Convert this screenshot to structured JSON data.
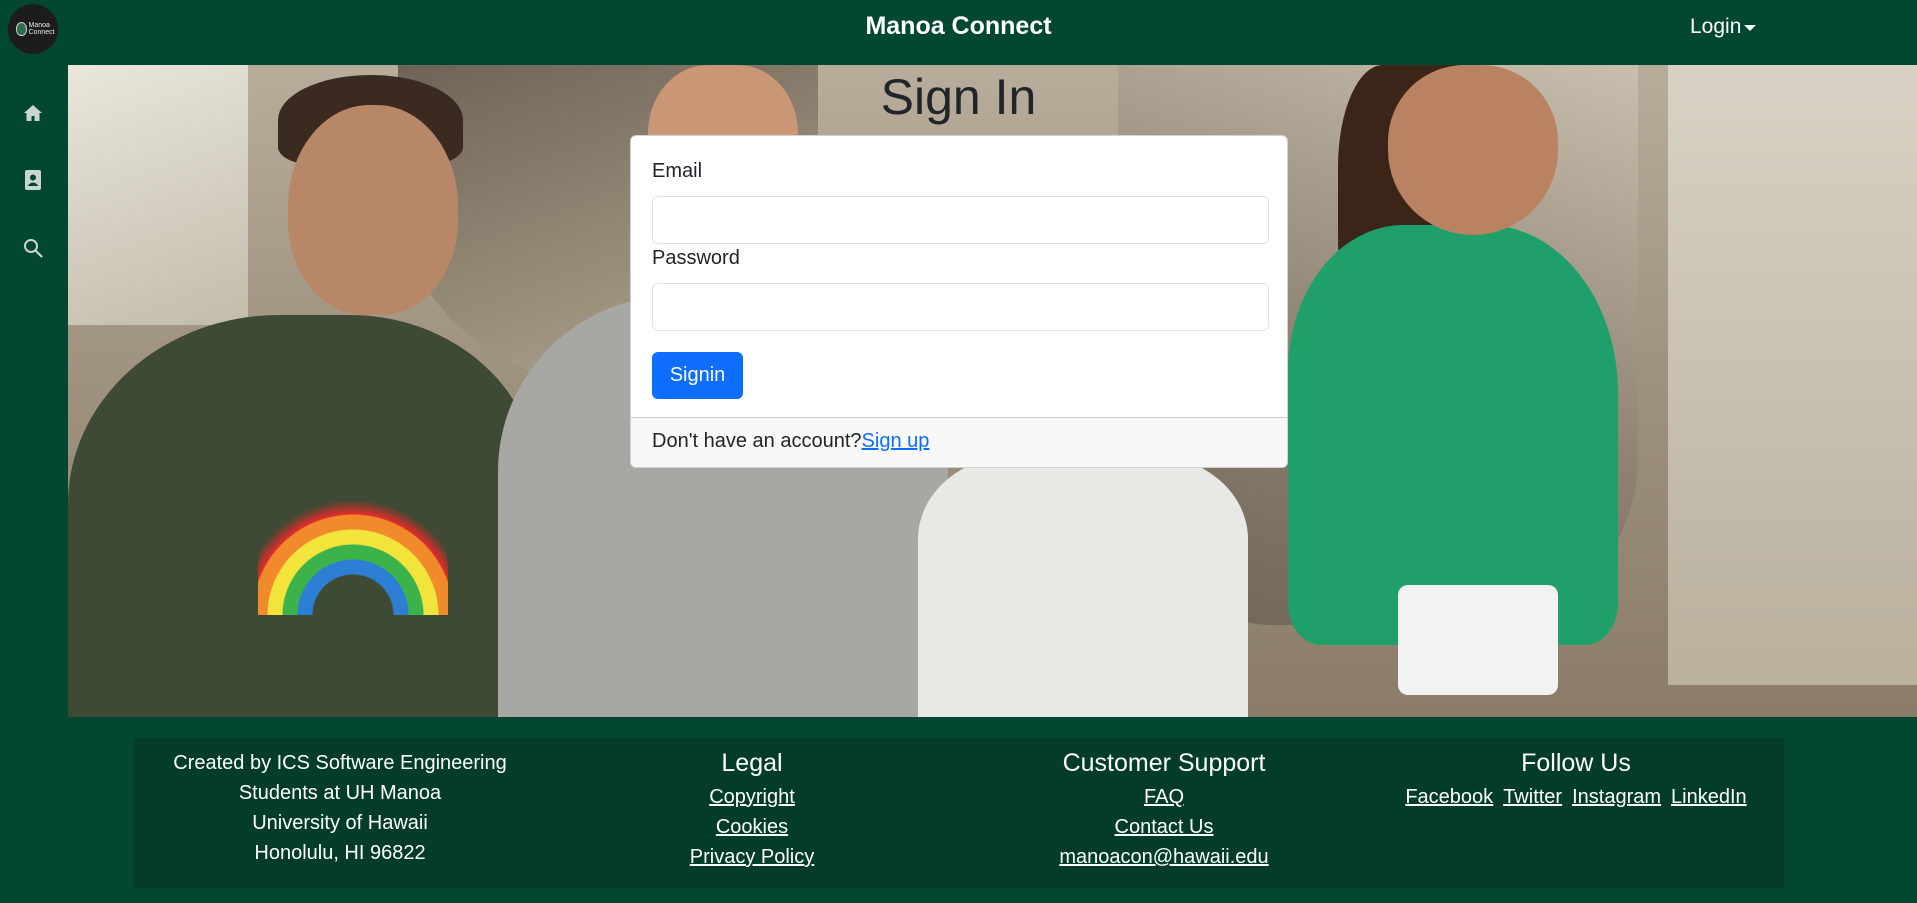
{
  "header": {
    "brand": "Manoa Connect",
    "logo_text": "Manoa Connect",
    "login_label": "Login"
  },
  "sidebar": {
    "items": [
      {
        "icon": "home-icon"
      },
      {
        "icon": "contact-book-icon"
      },
      {
        "icon": "search-icon"
      }
    ]
  },
  "page": {
    "title": "Sign In"
  },
  "form": {
    "email_label": "Email",
    "email_value": "",
    "password_label": "Password",
    "password_value": "",
    "submit_label": "Signin",
    "footer_text": "Don't have an account?",
    "signup_link": "Sign up"
  },
  "footer": {
    "about_lines": [
      "Created by ICS Software Engineering",
      "Students at UH Manoa",
      "University of Hawaii",
      "Honolulu, HI 96822"
    ],
    "legal": {
      "heading": "Legal",
      "links": [
        "Copyright",
        "Cookies",
        "Privacy Policy"
      ]
    },
    "support": {
      "heading": "Customer Support",
      "links": [
        "FAQ",
        "Contact Us",
        "manoacon@hawaii.edu"
      ]
    },
    "follow": {
      "heading": "Follow Us",
      "links": [
        "Facebook",
        "Twitter",
        "Instagram",
        "LinkedIn"
      ]
    }
  },
  "colors": {
    "brand_green": "#024731",
    "primary_button": "#0d6efd"
  }
}
